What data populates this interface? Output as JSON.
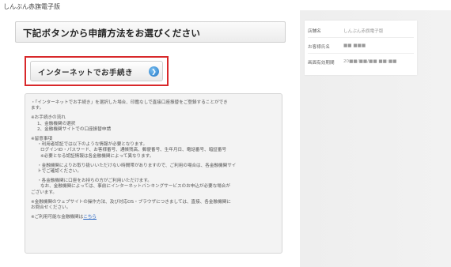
{
  "site": {
    "title": "しんぶん赤旗電子版"
  },
  "main": {
    "heading": "下記ボタンから申請方法をお選びください",
    "internet_button_label": "インターネットでお手続き"
  },
  "info": {
    "lines": [
      "・「インターネットでお手続き」を選択した場合、印鑑なしで直接口座振替をご登録することができ",
      "ます。",
      "※お手続きの流れ",
      "1、金融機関の選択",
      "2、金融機関サイトでの口座振替申請",
      "※留意事項",
      "・利用者認証では以下のような情報が必要となります。",
      "ログインID・パスワード、お客様番号、通帳残高、郵便番号、生年月日、電話番号、暗証番号",
      "※必要となる認証情報は各金融機関によって異なります。",
      "・金融機関によりお取り扱いいただけない時間帯がありますので、ご利用の場合は、各金融機関サイ",
      "トでご確認ください。",
      "・各金融機関に口座をお持ちの方がご利用いただけます。",
      "なお、金融機関によっては、事前にインターネットバンキングサービスのお申込が必要な場合が",
      "ございます。",
      "※金融機関のウェブサイトの操作方法、及び対応OS・ブラウザにつきましては、直接、各金融機関に",
      "お問合せください。",
      "※ご利用可能な金融機関は",
      "こちら"
    ]
  },
  "summary": {
    "rows": [
      {
        "key": "店舗名",
        "value": "しんぶん赤旗電子版"
      },
      {
        "key": "お客様氏名",
        "value": "■■ ■■■"
      },
      {
        "key": "画面有効期間",
        "value": "20■■/■■/■■ ■■:■■"
      }
    ]
  },
  "colors": {
    "highlight_border": "#d8282a",
    "arrow_icon": "#1f74c4",
    "link": "#1f5fc0"
  },
  "icons": {
    "button_arrow": "chevron-right-circle-icon"
  }
}
